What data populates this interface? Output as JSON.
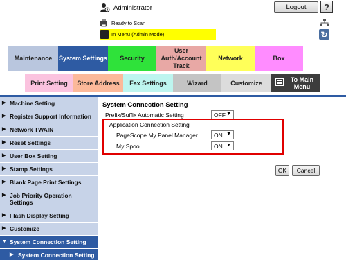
{
  "header": {
    "user_label": "Administrator",
    "logout_label": "Logout",
    "help_label": "?",
    "status_text": "Ready to Scan",
    "mode_text": "In Menu (Admin Mode)"
  },
  "main_tabs": [
    {
      "label": "Maintenance"
    },
    {
      "label": "System Settings"
    },
    {
      "label": "Security"
    },
    {
      "label": "User Auth/Account Track"
    },
    {
      "label": "Network"
    },
    {
      "label": "Box"
    }
  ],
  "sub_tabs": [
    {
      "label": "Print Setting"
    },
    {
      "label": "Store Address"
    },
    {
      "label": "Fax Settings"
    },
    {
      "label": "Wizard"
    },
    {
      "label": "Customize"
    },
    {
      "label": "To Main Menu"
    }
  ],
  "sidebar": {
    "items": [
      {
        "label": "Machine Setting"
      },
      {
        "label": "Register Support Information"
      },
      {
        "label": "Network TWAIN"
      },
      {
        "label": "Reset Settings"
      },
      {
        "label": "User Box Setting"
      },
      {
        "label": "Stamp Settings"
      },
      {
        "label": "Blank Page Print Settings"
      },
      {
        "label": "Job Priority Operation Settings"
      },
      {
        "label": "Flash Display Setting"
      },
      {
        "label": "Customize"
      },
      {
        "label": "System Connection Setting"
      },
      {
        "label": "System Connection Setting"
      }
    ]
  },
  "content": {
    "title": "System Connection Setting",
    "prefix_label": "Prefix/Suffix Automatic Setting",
    "prefix_value": "OFF",
    "app_section_label": "Application Connection Setting",
    "pagescope_label": "PageScope My Panel Manager",
    "pagescope_value": "ON",
    "myspool_label": "My Spool",
    "myspool_value": "ON",
    "ok_label": "OK",
    "cancel_label": "Cancel"
  }
}
